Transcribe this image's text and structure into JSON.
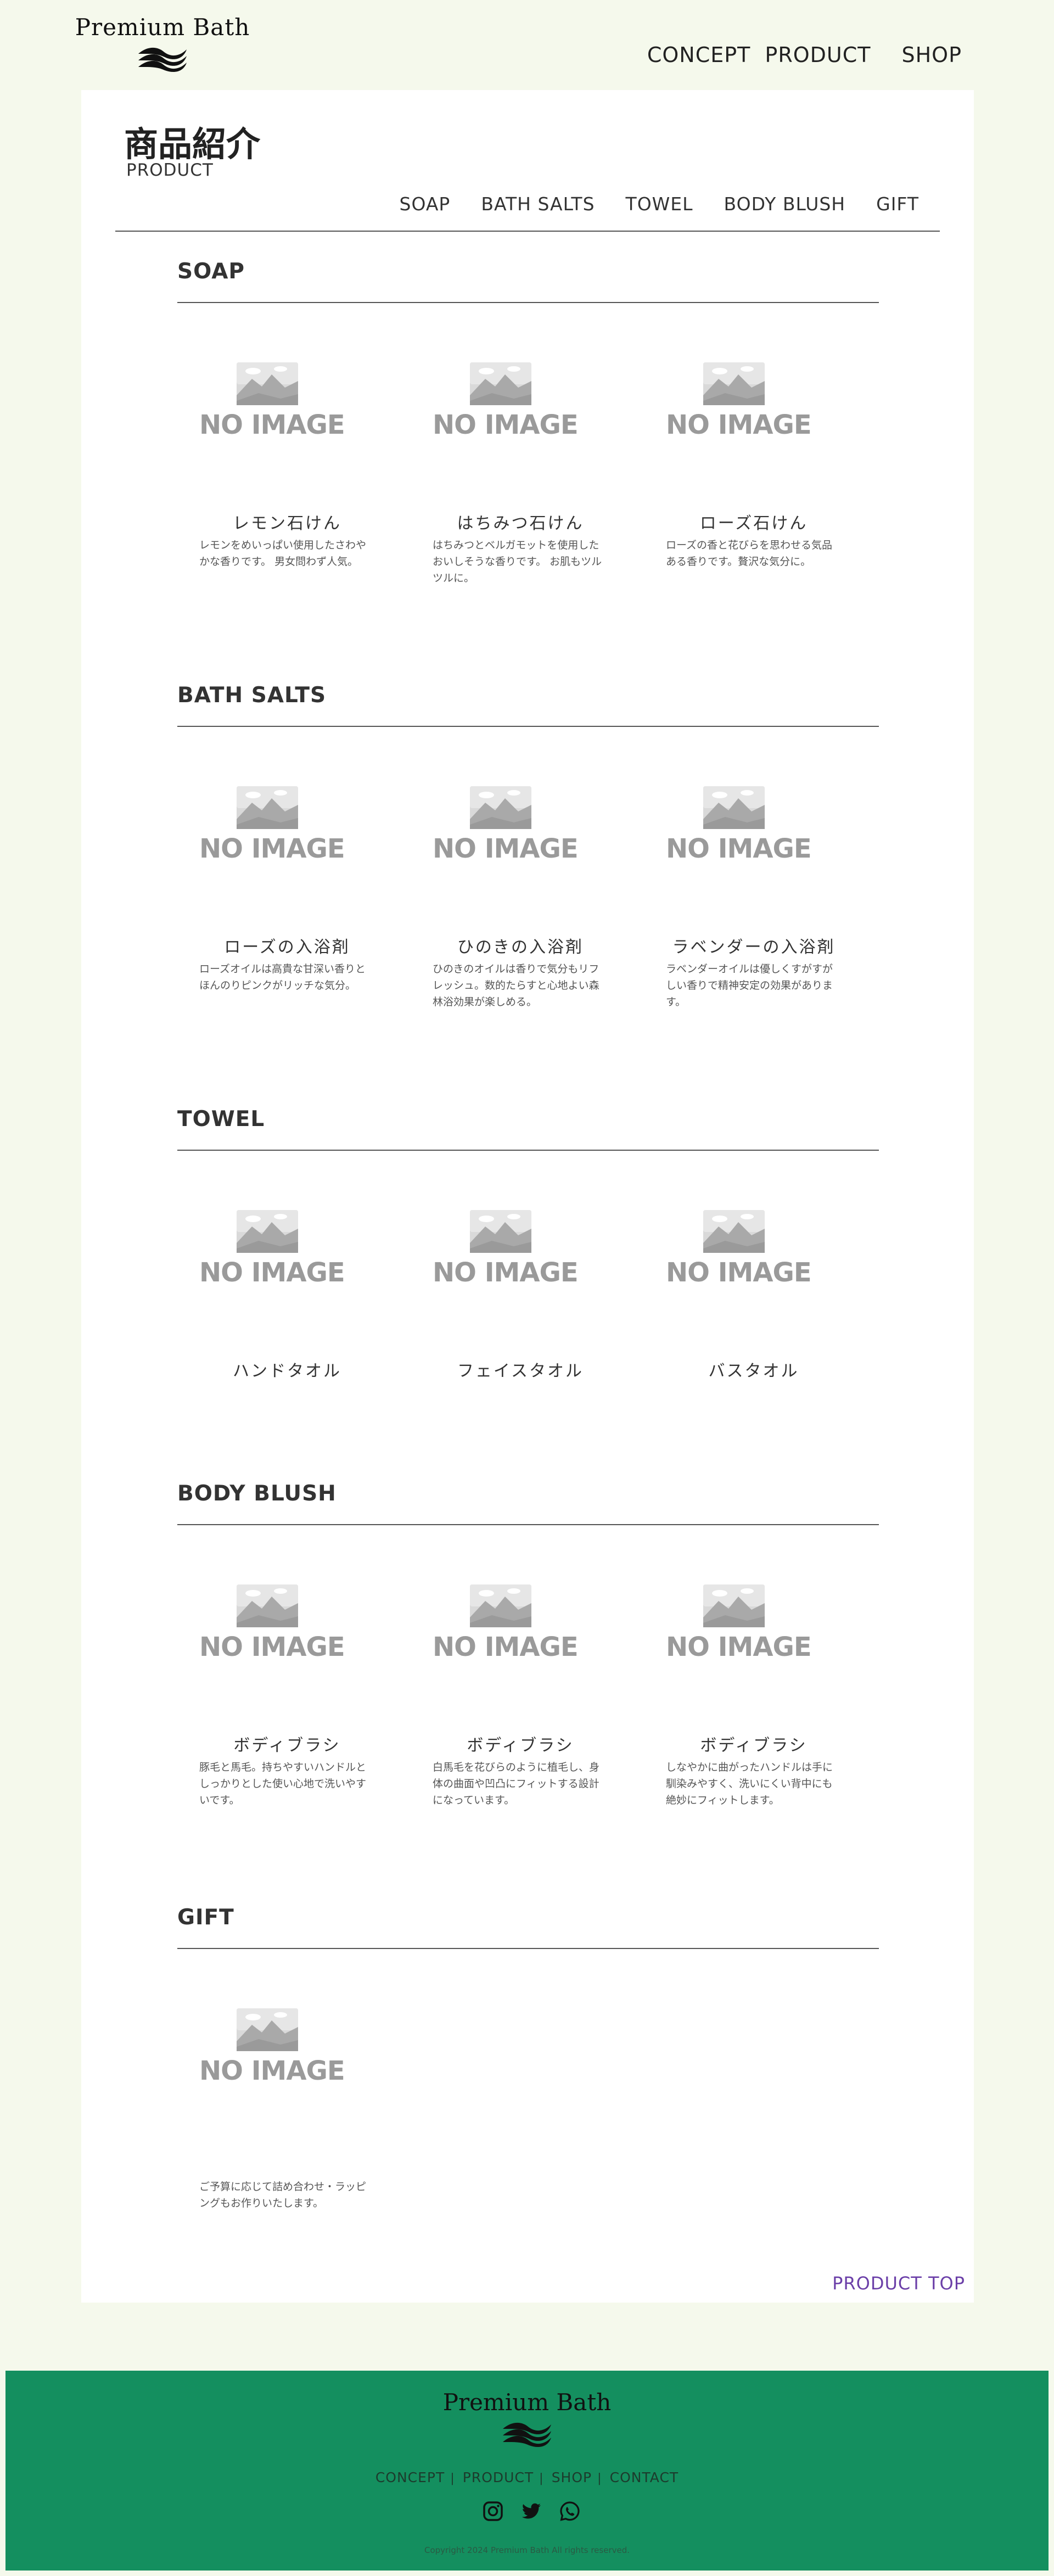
{
  "header": {
    "logo_text": "Premium Bath",
    "logo_icon": "waves-logo-icon",
    "nav": [
      {
        "label": "CONCEPT"
      },
      {
        "label": "PRODUCT"
      },
      {
        "label": "SHOP"
      }
    ]
  },
  "main": {
    "title": "商品紹介",
    "subtitle": "PRODUCT",
    "category_nav": [
      {
        "label": "SOAP"
      },
      {
        "label": "BATH SALTS"
      },
      {
        "label": "TOWEL"
      },
      {
        "label": "BODY BLUSH"
      },
      {
        "label": "GIFT"
      }
    ],
    "placeholder_text": "NO IMAGE",
    "placeholder_icon": "image-placeholder-icon",
    "sections": [
      {
        "title": "SOAP",
        "products": [
          {
            "name": "レモン石けん",
            "desc": "レモンをめいっぱい使用したさわやかな香りです。 男女問わず人気。"
          },
          {
            "name": "はちみつ石けん",
            "desc": "はちみつとベルガモットを使用したおいしそうな香りです。 お肌もツルツルに。"
          },
          {
            "name": "ローズ石けん",
            "desc": "ローズの香と花びらを思わせる気品ある香りです。贅沢な気分に。"
          }
        ]
      },
      {
        "title": "BATH SALTS",
        "products": [
          {
            "name": "ローズの入浴剤",
            "desc": "ローズオイルは高貴な甘深い香りとほんのりピンクがリッチな気分。"
          },
          {
            "name": "ひのきの入浴剤",
            "desc": "ひのきのオイルは香りで気分もリフレッシュ。数的たらすと心地よい森林浴効果が楽しめる。"
          },
          {
            "name": "ラベンダーの入浴剤",
            "desc": "ラベンダーオイルは優しくすがすがしい香りで精神安定の効果があります。"
          }
        ]
      },
      {
        "title": "TOWEL",
        "products": [
          {
            "name": "ハンドタオル",
            "desc": ""
          },
          {
            "name": "フェイスタオル",
            "desc": ""
          },
          {
            "name": "バスタオル",
            "desc": ""
          }
        ]
      },
      {
        "title": "BODY BLUSH",
        "products": [
          {
            "name": "ボディブラシ",
            "desc": "豚毛と馬毛。持ちやすいハンドルとしっかりとした使い心地で洗いやすいです。"
          },
          {
            "name": "ボディブラシ",
            "desc": "白馬毛を花びらのように植毛し、身体の曲面や凹凸にフィットする設計になっています。"
          },
          {
            "name": "ボディブラシ",
            "desc": "しなやかに曲がったハンドルは手に馴染みやすく、洗いにくい背中にも絶妙にフィットします。"
          }
        ]
      },
      {
        "title": "GIFT",
        "products": [
          {
            "name": "",
            "desc": "ご予算に応じて詰め合わせ・ラッピングもお作りいたします。"
          }
        ]
      }
    ],
    "product_top": "PRODUCT TOP"
  },
  "footer": {
    "logo_text": "Premium Bath",
    "nav": [
      {
        "label": "CONCEPT"
      },
      {
        "label": "PRODUCT"
      },
      {
        "label": "SHOP"
      },
      {
        "label": "CONTACT"
      }
    ],
    "separator": "|",
    "social_icons": [
      "instagram-icon",
      "twitter-icon",
      "whatsapp-icon"
    ],
    "copyright": "Copyright 2024 Premium Bath All rights reserved.",
    "colors": {
      "background": "#148f5f"
    }
  },
  "colors": {
    "page_background": "#f5f9ec",
    "card_background": "#ffffff",
    "accent_link": "#6b3fa8"
  }
}
